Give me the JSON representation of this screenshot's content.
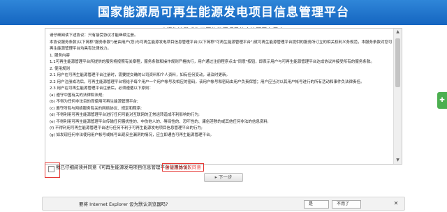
{
  "header": {
    "title": "国家能源局可再生能源发电项目信息管理平台"
  },
  "welcome": "欢迎您注册成为可再生能源项目信息管理平台用户!",
  "agreement": {
    "lines": [
      "请仔细阅读下述协议：只有接受协议才能继续注册。",
      "本协议服务条款(以下简称\"服务条款\")是由用户(您)与可再生能源发电项目信息管理平台(以下简称\"可再生能源管理平台\")就可再生能源管理平台提供的服务所订立的相关权利义务规范，本服务条款对您可",
      "再生能源管理平台均具有法律效力。",
      "1. 服务内容",
      "1.1可再生能源管理平台所提供的服务将按照有关章程，服务条款和操作规则严格执行，用户通过注册程序点击\"同意\"按钮，即表示用户与可再生能源管理平台达成协议并接受所有的服务条款。",
      "",
      "2. 使用规则",
      "2.1 用户在可再生能源管理平台注册时，需要提交确的公司资料和个人资料，如有任何变动，请及时更新。",
      "2.2 用户注册成功后，可再生能源管理平台将给予每个用户一个用户帐号及相应的密码，该用户帐号和密码由用户负责保管；用户应当对以其用户帐号进行的所有活动和事件负法律责任。",
      "2.3 用户在可再生能源管理平台注册后，必须遵循以下原则：",
      "(a) 遵守中国有关的法律和法规;",
      "(b) 不得为任何非法目的而使用可再生能源管理平台;",
      "(c) 遵守所有与网络服务有关的网络协议、规定和程序;",
      "(d) 不得利用可再生能源管理平台进行任何可能对互联网的正常运转造成不利影响的行为;",
      "(e) 不得利用可再生能源管理平台传输任何骚扰性的、中伤他人的、辱骂性的、恐吓性的、庸俗淫秽的或其他任何非法的信息资料;",
      "(f) 不得利用可再生能源管理平台进行任何不利于可再生能源发电项目信息管理平台的行为;",
      "(g) 如发现任何非法使用用户帐号或帐号出现安全漏洞的情况，应立即通告可再生能源管理平台。"
    ]
  },
  "agree": {
    "text": "我已仔细阅读并同意《可再生能源发电项目信息管理平台使用协议》",
    "warning": "请勾选此协议同意"
  },
  "next_button": "下一步",
  "ie_prompt": {
    "message": "要将 Internet Explorer 设为默认浏览器吗?",
    "yes": "是",
    "no": "不用了"
  },
  "icons": {
    "side_tab": "share-icon",
    "close": "close-icon",
    "scroll_up": "arrow-up-icon",
    "scroll_down": "arrow-down-icon"
  },
  "colors": {
    "header": "#1565c0",
    "warning": "#e53935",
    "side_tab": "#4caf50"
  }
}
